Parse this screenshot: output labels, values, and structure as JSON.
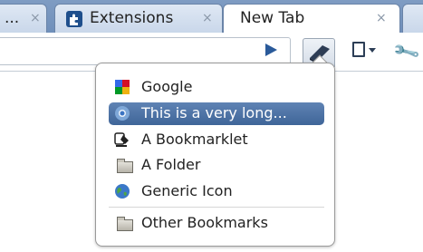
{
  "tabs": [
    {
      "title": "...",
      "close": "×"
    },
    {
      "title": "Extensions",
      "close": "×",
      "icon": "puzzle-icon"
    },
    {
      "title": "New Tab",
      "close": "×"
    },
    {
      "title": "",
      "close": ""
    }
  ],
  "toolbar": {
    "go_icon": "play-arrow-icon",
    "bookmarks_icon": "book-icon",
    "page_icon": "page-icon",
    "wrench_icon": "wrench-icon"
  },
  "menu": {
    "items": [
      {
        "label": "Google",
        "icon": "google-icon"
      },
      {
        "label": "This is a very long...",
        "icon": "chrome-icon",
        "selected": true
      },
      {
        "label": "A Bookmarklet",
        "icon": "bookmarklet-icon"
      },
      {
        "label": "A Folder",
        "icon": "folder-icon"
      },
      {
        "label": "Generic Icon",
        "icon": "globe-icon"
      }
    ],
    "other": {
      "label": "Other Bookmarks",
      "icon": "folder-icon"
    }
  },
  "colors": {
    "selection": "#4a6fa3",
    "tabstrip": "#7a97bf"
  }
}
